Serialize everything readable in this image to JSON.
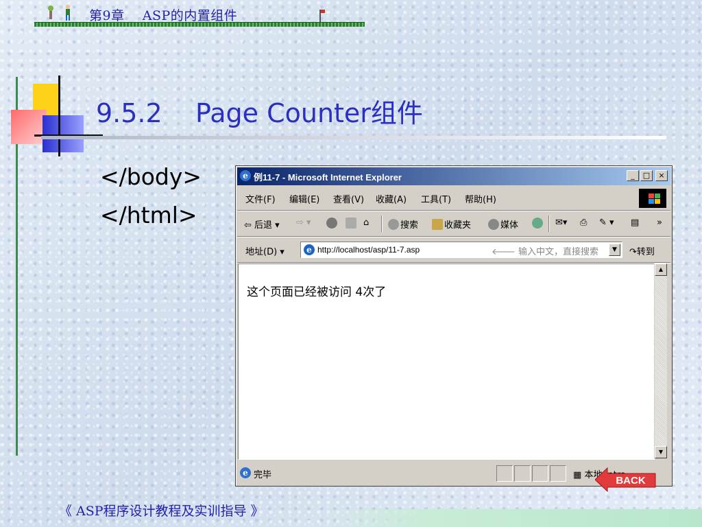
{
  "header": {
    "chapter": "第9章    ASP的内置组件"
  },
  "slide": {
    "title": "9.5.2    Page Counter组件",
    "code_lines": [
      "</body>",
      "</html>"
    ]
  },
  "browser": {
    "window_title": "例11-7 - Microsoft Internet Explorer",
    "title_buttons": [
      "_",
      "□",
      "×"
    ],
    "menu": [
      "文件(F)",
      "编辑(E)",
      "查看(V)",
      "收藏(A)",
      "工具(T)",
      "帮助(H)"
    ],
    "toolbar": {
      "back": "⇦ 后退",
      "search": "搜索",
      "favorites": "收藏夹",
      "media": "媒体",
      "more": "»"
    },
    "address": {
      "label": "地址(D)",
      "url": "http://localhost/asp/11-7.asp",
      "search_hint": "🡐 输入中文，直接搜索",
      "go": "转到"
    },
    "content_text": "这个页面已经被访问 4次了",
    "status": {
      "text": "完毕",
      "zone": "本地 Intra"
    }
  },
  "nav": {
    "back_label": "BACK"
  },
  "footer": {
    "text": "《 ASP程序设计教程及实训指导 》"
  },
  "colors": {
    "title_blue": "#2a2fbf",
    "header_blue": "#2222aa",
    "titlebar_start": "#0a246a",
    "titlebar_end": "#a6caf0",
    "accent_green": "#3d8a4d",
    "back_red": "#e23b3b"
  }
}
